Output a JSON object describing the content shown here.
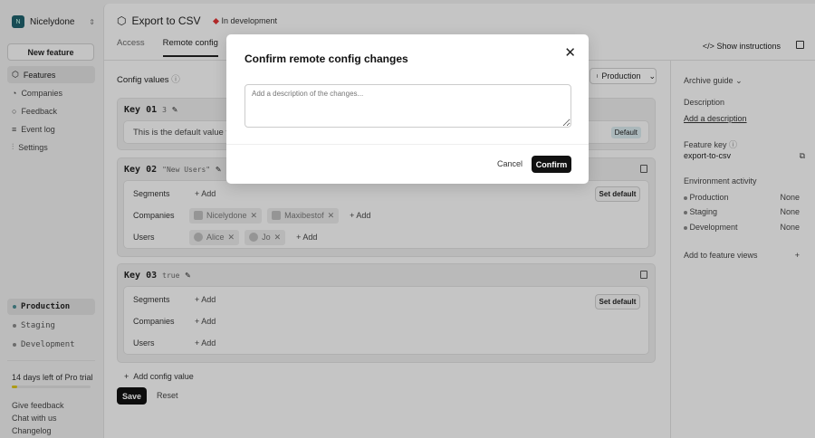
{
  "sidebar": {
    "org_initial": "N",
    "org_name": "Nicelydone",
    "new_feature": "New feature",
    "nav": [
      "Features",
      "Companies",
      "Feedback",
      "Event log",
      "Settings"
    ],
    "envs": [
      "Production",
      "Staging",
      "Development"
    ],
    "trial": "14 days left of Pro trial",
    "trial_progress": 0.07,
    "footer": [
      "Give feedback",
      "Chat with us",
      "Changelog"
    ]
  },
  "header": {
    "title": "Export to CSV",
    "status": "In development",
    "tabs": [
      "Access",
      "Remote config"
    ],
    "show_instructions": "Show instructions"
  },
  "content": {
    "config_title": "Config values",
    "env_select": "Production",
    "keys": [
      {
        "name": "Key 01",
        "value": "3",
        "default_text": "This is the default value for the",
        "default_badge": "Default"
      },
      {
        "name": "Key 02",
        "value": "\"New Users\"",
        "segments": "Segments",
        "companies": "Companies",
        "users": "Users",
        "company_chips": [
          "Nicelydone",
          "Maxibestof"
        ],
        "user_chips": [
          "Alice",
          "Jo"
        ],
        "add": "Add",
        "set_default": "Set default"
      },
      {
        "name": "Key 03",
        "value": "true",
        "segments": "Segments",
        "companies": "Companies",
        "users": "Users",
        "add": "Add",
        "set_default": "Set default"
      }
    ],
    "add_config": "Add config value",
    "save": "Save",
    "reset": "Reset"
  },
  "right": {
    "archive": "Archive guide",
    "description_label": "Description",
    "add_description": "Add a description",
    "feature_key_label": "Feature key",
    "feature_key": "export-to-csv",
    "env_activity": "Environment activity",
    "activity": [
      {
        "env": "Production",
        "value": "None"
      },
      {
        "env": "Staging",
        "value": "None"
      },
      {
        "env": "Development",
        "value": "None"
      }
    ],
    "add_views": "Add to feature views"
  },
  "modal": {
    "title": "Confirm remote config changes",
    "placeholder": "Add a description of the changes...",
    "cancel": "Cancel",
    "confirm": "Confirm"
  }
}
